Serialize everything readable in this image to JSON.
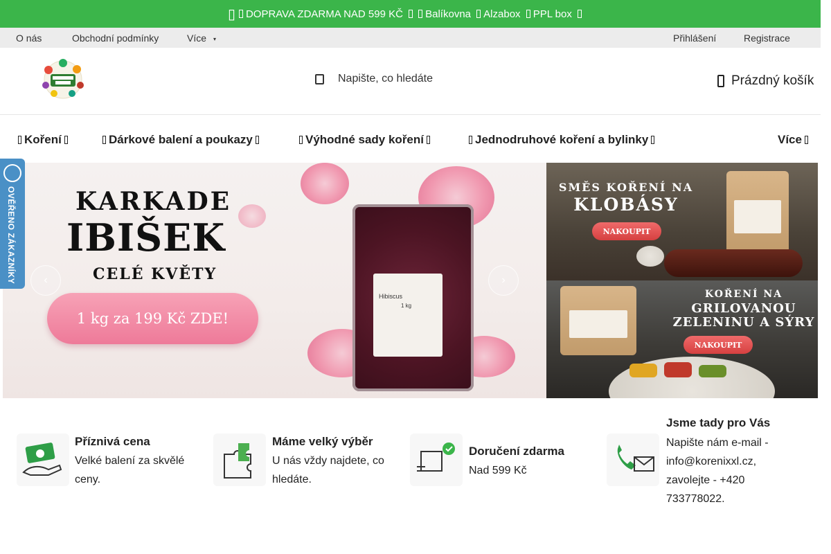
{
  "promo": {
    "text": "DOPRAVA ZDARMA NAD 599 KČ",
    "carrier1": "Balíkovna",
    "carrier2": "Alzabox",
    "carrier3": "PPL box"
  },
  "subnav": {
    "about": "O nás",
    "terms": "Obchodní podmínky",
    "more": "Více",
    "login": "Přihlášení",
    "register": "Registrace"
  },
  "header": {
    "search_placeholder": "Napište, co hledáte",
    "cart": "Prázdný košík"
  },
  "menu": {
    "items": [
      {
        "label": "Koření"
      },
      {
        "label": "Dárkové balení a poukazy"
      },
      {
        "label": "Výhodné sady koření"
      },
      {
        "label": "Jednodruhové koření a bylinky"
      }
    ],
    "more": "Více"
  },
  "banner_main": {
    "title1": "KARKADE",
    "title2": "IBIŠEK",
    "title3": "CELÉ KVĚTY",
    "cta": "1 kg za 199 Kč ZDE!",
    "bag_title": "Hibiscus",
    "bag_weight": "1 kg"
  },
  "banner_side_top": {
    "line1": "SMĚS KOŘENÍ NA",
    "line2": "KLOBÁSY",
    "cta": "NAKOUPIT"
  },
  "banner_side_bottom": {
    "line1": "KOŘENÍ NA",
    "line2": "GRILOVANOU",
    "line3": "ZELENINU A SÝRY",
    "cta": "NAKOUPIT"
  },
  "verified_badge": {
    "text": "OVĚŘENO ZÁKAZNÍKY"
  },
  "features": [
    {
      "title": "Příznivá cena",
      "text": "Velké balení za skvělé ceny."
    },
    {
      "title": "Máme velký výběr",
      "text": "U nás vždy najdete, co hledáte."
    },
    {
      "title": "Doručení zdarma",
      "text": "Nad 599 Kč"
    },
    {
      "title": "Jsme tady pro Vás",
      "text": "Napište nám e-mail - info@korenixxl.cz, zavolejte - +420 733778022."
    }
  ],
  "colors": {
    "promo_green": "#3bb54a",
    "subnav_gray": "#ececec",
    "cta_pink": "#ee7a99",
    "badge_blue": "#4a90c6"
  }
}
